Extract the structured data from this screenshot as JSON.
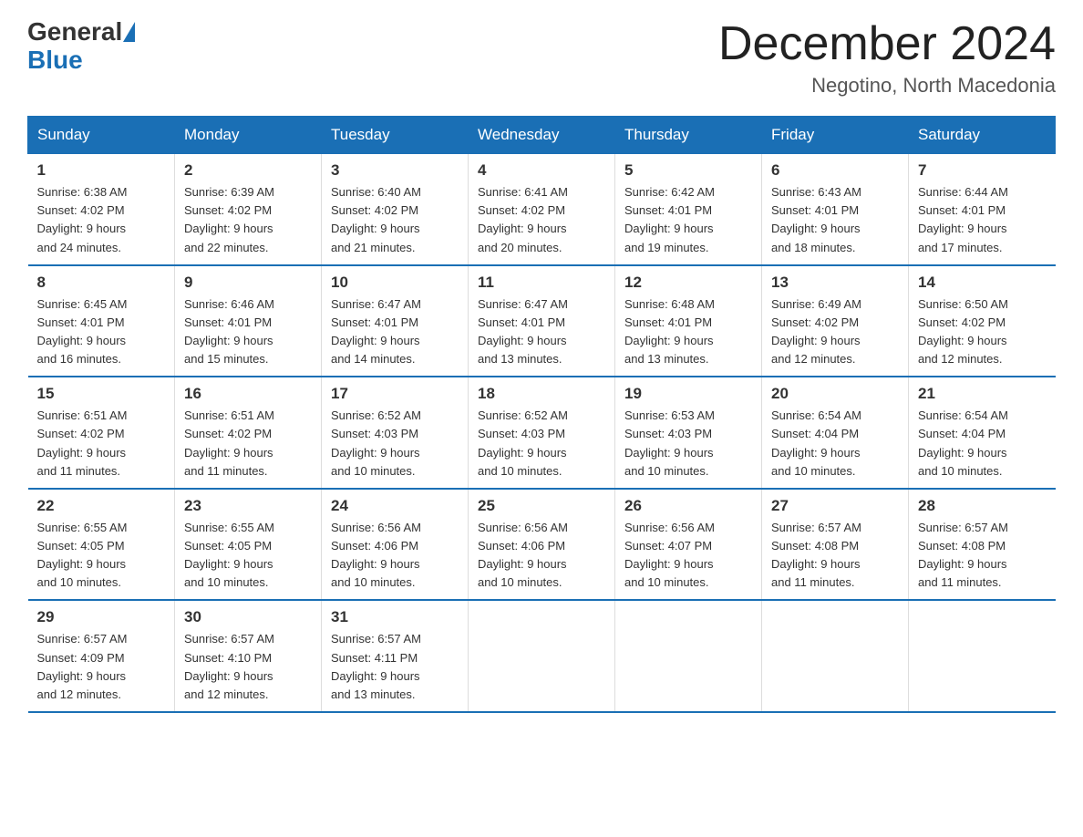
{
  "header": {
    "logo_general": "General",
    "logo_blue": "Blue",
    "title": "December 2024",
    "subtitle": "Negotino, North Macedonia"
  },
  "weekdays": [
    "Sunday",
    "Monday",
    "Tuesday",
    "Wednesday",
    "Thursday",
    "Friday",
    "Saturday"
  ],
  "weeks": [
    [
      {
        "day": "1",
        "sunrise": "6:38 AM",
        "sunset": "4:02 PM",
        "daylight": "9 hours and 24 minutes."
      },
      {
        "day": "2",
        "sunrise": "6:39 AM",
        "sunset": "4:02 PM",
        "daylight": "9 hours and 22 minutes."
      },
      {
        "day": "3",
        "sunrise": "6:40 AM",
        "sunset": "4:02 PM",
        "daylight": "9 hours and 21 minutes."
      },
      {
        "day": "4",
        "sunrise": "6:41 AM",
        "sunset": "4:02 PM",
        "daylight": "9 hours and 20 minutes."
      },
      {
        "day": "5",
        "sunrise": "6:42 AM",
        "sunset": "4:01 PM",
        "daylight": "9 hours and 19 minutes."
      },
      {
        "day": "6",
        "sunrise": "6:43 AM",
        "sunset": "4:01 PM",
        "daylight": "9 hours and 18 minutes."
      },
      {
        "day": "7",
        "sunrise": "6:44 AM",
        "sunset": "4:01 PM",
        "daylight": "9 hours and 17 minutes."
      }
    ],
    [
      {
        "day": "8",
        "sunrise": "6:45 AM",
        "sunset": "4:01 PM",
        "daylight": "9 hours and 16 minutes."
      },
      {
        "day": "9",
        "sunrise": "6:46 AM",
        "sunset": "4:01 PM",
        "daylight": "9 hours and 15 minutes."
      },
      {
        "day": "10",
        "sunrise": "6:47 AM",
        "sunset": "4:01 PM",
        "daylight": "9 hours and 14 minutes."
      },
      {
        "day": "11",
        "sunrise": "6:47 AM",
        "sunset": "4:01 PM",
        "daylight": "9 hours and 13 minutes."
      },
      {
        "day": "12",
        "sunrise": "6:48 AM",
        "sunset": "4:01 PM",
        "daylight": "9 hours and 13 minutes."
      },
      {
        "day": "13",
        "sunrise": "6:49 AM",
        "sunset": "4:02 PM",
        "daylight": "9 hours and 12 minutes."
      },
      {
        "day": "14",
        "sunrise": "6:50 AM",
        "sunset": "4:02 PM",
        "daylight": "9 hours and 12 minutes."
      }
    ],
    [
      {
        "day": "15",
        "sunrise": "6:51 AM",
        "sunset": "4:02 PM",
        "daylight": "9 hours and 11 minutes."
      },
      {
        "day": "16",
        "sunrise": "6:51 AM",
        "sunset": "4:02 PM",
        "daylight": "9 hours and 11 minutes."
      },
      {
        "day": "17",
        "sunrise": "6:52 AM",
        "sunset": "4:03 PM",
        "daylight": "9 hours and 10 minutes."
      },
      {
        "day": "18",
        "sunrise": "6:52 AM",
        "sunset": "4:03 PM",
        "daylight": "9 hours and 10 minutes."
      },
      {
        "day": "19",
        "sunrise": "6:53 AM",
        "sunset": "4:03 PM",
        "daylight": "9 hours and 10 minutes."
      },
      {
        "day": "20",
        "sunrise": "6:54 AM",
        "sunset": "4:04 PM",
        "daylight": "9 hours and 10 minutes."
      },
      {
        "day": "21",
        "sunrise": "6:54 AM",
        "sunset": "4:04 PM",
        "daylight": "9 hours and 10 minutes."
      }
    ],
    [
      {
        "day": "22",
        "sunrise": "6:55 AM",
        "sunset": "4:05 PM",
        "daylight": "9 hours and 10 minutes."
      },
      {
        "day": "23",
        "sunrise": "6:55 AM",
        "sunset": "4:05 PM",
        "daylight": "9 hours and 10 minutes."
      },
      {
        "day": "24",
        "sunrise": "6:56 AM",
        "sunset": "4:06 PM",
        "daylight": "9 hours and 10 minutes."
      },
      {
        "day": "25",
        "sunrise": "6:56 AM",
        "sunset": "4:06 PM",
        "daylight": "9 hours and 10 minutes."
      },
      {
        "day": "26",
        "sunrise": "6:56 AM",
        "sunset": "4:07 PM",
        "daylight": "9 hours and 10 minutes."
      },
      {
        "day": "27",
        "sunrise": "6:57 AM",
        "sunset": "4:08 PM",
        "daylight": "9 hours and 11 minutes."
      },
      {
        "day": "28",
        "sunrise": "6:57 AM",
        "sunset": "4:08 PM",
        "daylight": "9 hours and 11 minutes."
      }
    ],
    [
      {
        "day": "29",
        "sunrise": "6:57 AM",
        "sunset": "4:09 PM",
        "daylight": "9 hours and 12 minutes."
      },
      {
        "day": "30",
        "sunrise": "6:57 AM",
        "sunset": "4:10 PM",
        "daylight": "9 hours and 12 minutes."
      },
      {
        "day": "31",
        "sunrise": "6:57 AM",
        "sunset": "4:11 PM",
        "daylight": "9 hours and 13 minutes."
      },
      null,
      null,
      null,
      null
    ]
  ],
  "labels": {
    "sunrise": "Sunrise:",
    "sunset": "Sunset:",
    "daylight": "Daylight:"
  }
}
